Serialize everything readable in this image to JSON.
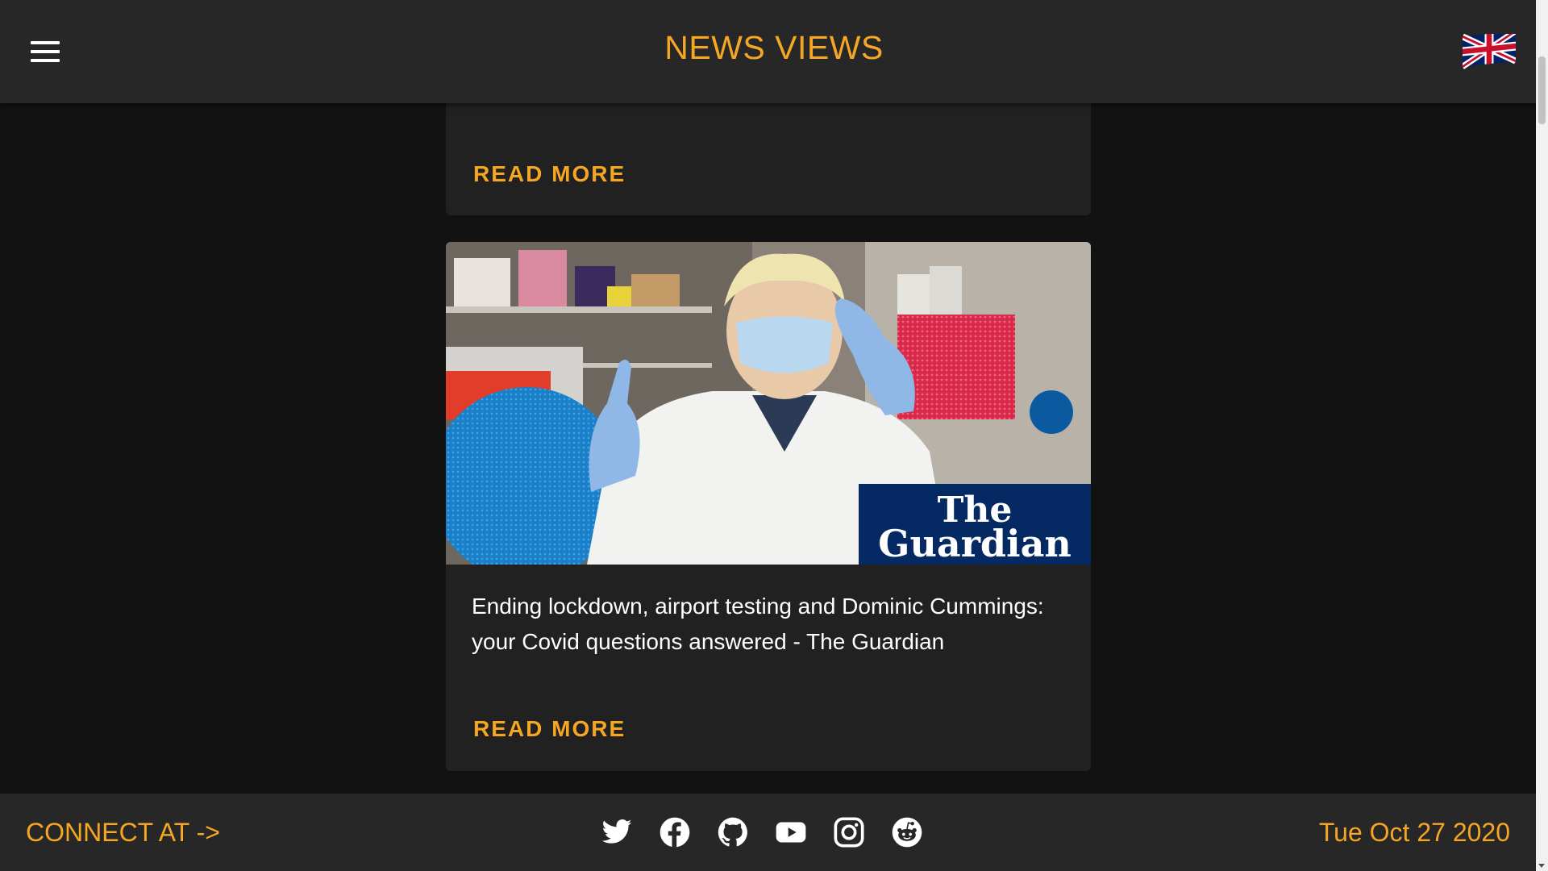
{
  "header": {
    "brand": "NEWS VIEWS",
    "menu_icon": "hamburger-menu-icon",
    "language_flag": "uk-flag-icon"
  },
  "articles": [
    {
      "title": "",
      "read_more": "READ MORE"
    },
    {
      "image": "news-photo",
      "image_badge_line1": "The",
      "image_badge_line2": "Guardian",
      "title": "Ending lockdown, airport testing and Dominic Cummings: your Covid questions answered - The Guardian",
      "read_more": "READ MORE"
    }
  ],
  "footer": {
    "connect_label": "CONNECT AT ->",
    "social": [
      "twitter-icon",
      "facebook-icon",
      "github-icon",
      "youtube-icon",
      "instagram-icon",
      "reddit-icon"
    ],
    "date": "Tue Oct 27 2020"
  },
  "colors": {
    "accent": "#f5a623",
    "header_bg": "#272727",
    "page_bg": "#121212",
    "card_bg": "#212121"
  }
}
